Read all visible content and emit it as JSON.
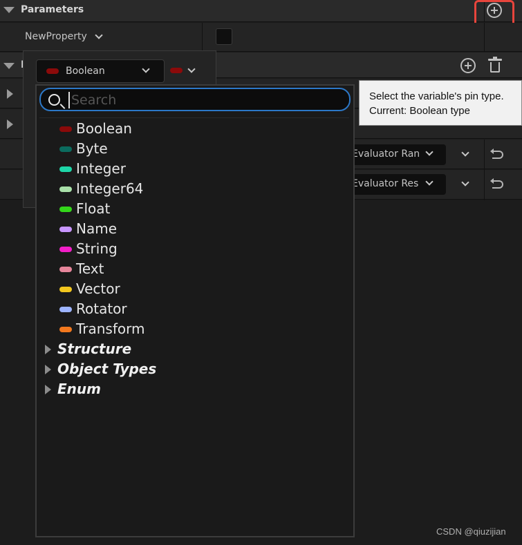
{
  "panel": {
    "parameters_title": "Parameters",
    "property_name": "NewProperty",
    "second_section_initial": "I",
    "eval_options": [
      "Evaluator Ran",
      "Evaluator Res"
    ]
  },
  "type_picker": {
    "selected_type": "Boolean",
    "selected_color": "#8b0a0a",
    "search_placeholder": "Search",
    "search_value": "",
    "types": [
      {
        "label": "Boolean",
        "color": "#8b0a0a"
      },
      {
        "label": "Byte",
        "color": "#0b6b5e"
      },
      {
        "label": "Integer",
        "color": "#1ed6a8"
      },
      {
        "label": "Integer64",
        "color": "#a9e0a9"
      },
      {
        "label": "Float",
        "color": "#33d61a"
      },
      {
        "label": "Name",
        "color": "#c896ff"
      },
      {
        "label": "String",
        "color": "#f21ec8"
      },
      {
        "label": "Text",
        "color": "#e6869b"
      },
      {
        "label": "Vector",
        "color": "#f2c61e"
      },
      {
        "label": "Rotator",
        "color": "#9db4ff"
      },
      {
        "label": "Transform",
        "color": "#f2781e"
      }
    ],
    "categories": [
      "Structure",
      "Object Types",
      "Enum"
    ]
  },
  "tooltip": {
    "line1": "Select the variable's pin type.",
    "line2": "Current: Boolean type"
  },
  "watermark": "CSDN @qiuzijian",
  "colors": {
    "highlight_box": "#e8453c",
    "search_focus": "#2c78c8"
  }
}
